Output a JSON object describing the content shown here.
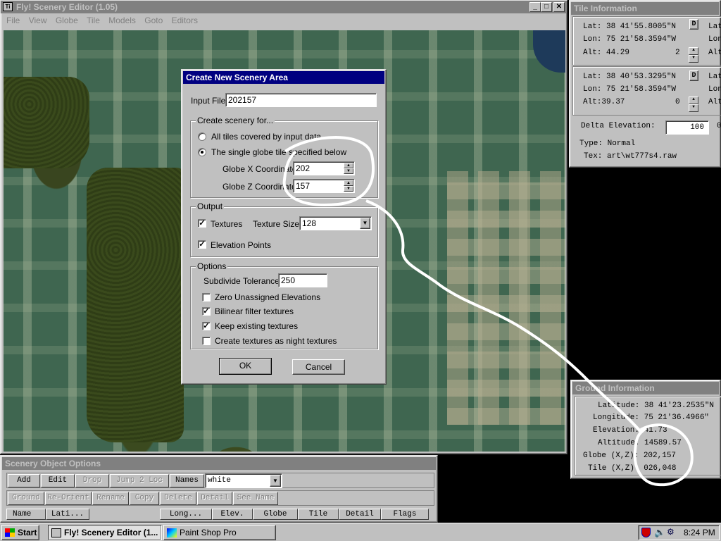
{
  "main_window": {
    "title": "Fly! Scenery Editor (1.05)",
    "menu": [
      "File",
      "View",
      "Globe",
      "Tile",
      "Models",
      "Goto",
      "Editors"
    ]
  },
  "dialog": {
    "title": "Create New Scenery Area",
    "input_file_label": "Input File",
    "input_file_value": "202157",
    "create_group": "Create scenery for...",
    "radio_all": "All tiles covered by input data",
    "radio_single": "The single globe tile specified below",
    "globe_x_label": "Globe X Coordinate",
    "globe_x_value": "202",
    "globe_z_label": "Globe Z Coordinate",
    "globe_z_value": "157",
    "output_group": "Output",
    "textures_label": "Textures",
    "texture_size_label": "Texture Size",
    "texture_size_value": "128",
    "elevation_points_label": "Elevation Points",
    "options_group": "Options",
    "subdivide_label": "Subdivide Tolerance",
    "subdivide_value": "250",
    "opt_zero": "Zero Unassigned Elevations",
    "opt_bilinear": "Bilinear filter textures",
    "opt_keep": "Keep existing textures",
    "opt_night": "Create textures as night textures",
    "ok": "OK",
    "cancel": "Cancel"
  },
  "tile_info": {
    "title": "Tile Information",
    "row1": {
      "lat": "Lat: 38 41'55.8005\"N",
      "lon": "Lon:  75 21'58.3594\"W",
      "alt": "Alt: 44.29",
      "num": "2",
      "btn": "D"
    },
    "row2": {
      "lat": "Lat: 38 40'53.3295\"N",
      "lon": "Lon:  75 21'58.3594\"W",
      "alt": "Alt:39.37",
      "num": "0",
      "btn": "D"
    },
    "cut_lat": "Lat",
    "cut_lon": "Lon",
    "cut_alt": "Alt",
    "delta_label": "Delta Elevation:",
    "delta_value": "100",
    "delta_cut": "0",
    "type": "Type: Normal",
    "tex": "Tex: art\\wt777s4.raw"
  },
  "ground_info": {
    "title": "Ground Information",
    "latitude": "Latitude: 38 41'23.2535\"N",
    "longitude": "Longitude:  75 21'36.4966\"",
    "elevation": "Elevation:    41.73",
    "altitude": "Altitude:   14589.57",
    "globe": "Globe (X,Z): 202,157",
    "tile": "Tile (X,Z): 026,048"
  },
  "scenery_options": {
    "title": "Scenery Object Options",
    "buttons_row1": [
      "Add",
      "Edit",
      "Drop",
      "Jump 2 Loc",
      "Names"
    ],
    "names_value": "white",
    "buttons_row2": [
      "Ground",
      "Re-Orient",
      "Rename",
      "Copy",
      "Delete",
      "Detail",
      "See Name"
    ],
    "columns": [
      "Name",
      "Lati...",
      "Long...",
      "Elev.",
      "Globe",
      "Tile",
      "Detail",
      "Flags"
    ]
  },
  "taskbar": {
    "start": "Start",
    "tasks": [
      "Fly! Scenery Editor (1...",
      "Paint Shop Pro"
    ],
    "clock": "8:24 PM"
  }
}
